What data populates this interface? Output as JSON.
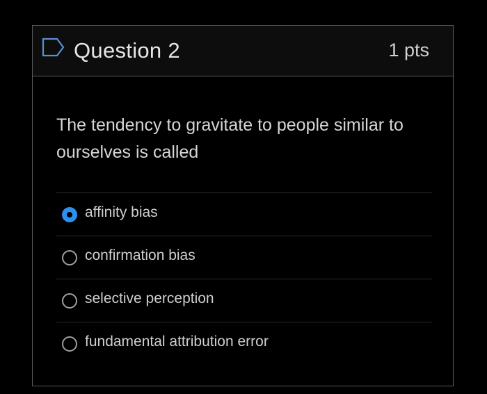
{
  "question": {
    "title": "Question 2",
    "points": "1 pts",
    "text": "The tendency to gravitate to people similar to ourselves is called"
  },
  "answers": [
    {
      "label": "affinity bias",
      "selected": true
    },
    {
      "label": "confirmation bias",
      "selected": false
    },
    {
      "label": "selective perception",
      "selected": false
    },
    {
      "label": "fundamental attribution error",
      "selected": false
    }
  ],
  "colors": {
    "accent": "#2d8fee",
    "flag_icon": "#5a8fd0"
  },
  "icons": {
    "flag": "flag-icon"
  }
}
